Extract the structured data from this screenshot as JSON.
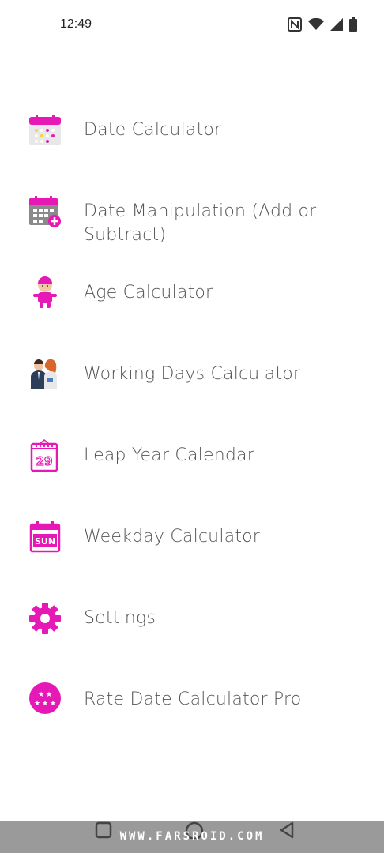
{
  "status": {
    "time": "12:49"
  },
  "menu": {
    "items": [
      {
        "label": "Date Calculator",
        "icon": "calendar-icon"
      },
      {
        "label": "Date Manipulation (Add or Subtract)",
        "icon": "calendar-add-icon"
      },
      {
        "label": "Age Calculator",
        "icon": "baby-icon"
      },
      {
        "label": "Working Days Calculator",
        "icon": "workers-icon"
      },
      {
        "label": "Leap Year Calendar",
        "icon": "calendar-29-icon"
      },
      {
        "label": "Weekday Calculator",
        "icon": "calendar-sun-icon"
      },
      {
        "label": "Settings",
        "icon": "gear-icon"
      },
      {
        "label": "Rate Date Calculator Pro",
        "icon": "star-rating-icon"
      }
    ]
  },
  "icon_labels": {
    "leap_day": "29",
    "weekday": "SUN"
  },
  "watermark": "WWW.FARSROID.COM",
  "colors": {
    "accent": "#e619b7",
    "text": "#555555",
    "nav_bar": "#9a9a9a"
  }
}
